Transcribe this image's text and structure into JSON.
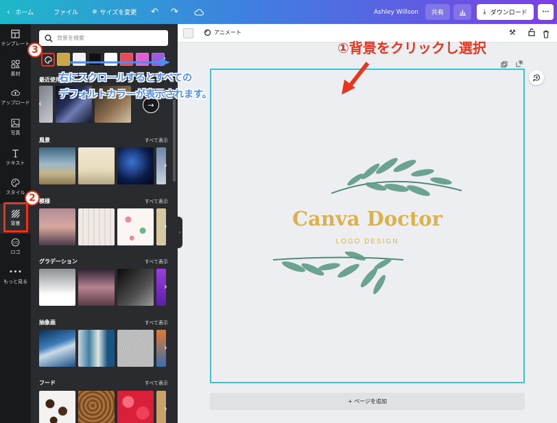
{
  "topbar": {
    "home": "ホーム",
    "file": "ファイル",
    "resize": "サイズを変更",
    "user": "Ashley Willson",
    "share": "共有",
    "download": "ダウンロード"
  },
  "rail": {
    "items": [
      {
        "label": "テンプレート",
        "icon": "layout-icon"
      },
      {
        "label": "素材",
        "icon": "shapes-icon"
      },
      {
        "label": "アップロード",
        "icon": "upload-icon"
      },
      {
        "label": "写真",
        "icon": "photo-icon"
      },
      {
        "label": "テキスト",
        "icon": "text-icon"
      },
      {
        "label": "スタイル",
        "icon": "palette-icon"
      },
      {
        "label": "背景",
        "icon": "background-icon"
      },
      {
        "label": "ロゴ",
        "icon": "logo-icon"
      },
      {
        "label": "もっと見る",
        "icon": "more-icon"
      }
    ]
  },
  "panel": {
    "search_placeholder": "背景を検索",
    "swatches": [
      "#c9a748",
      "#f2f2f2",
      "#111111",
      "#ffffff",
      "#e84a57",
      "#e25fd3",
      "#9b5be0"
    ],
    "recent_title": "最近使用",
    "sections": [
      {
        "title": "風景",
        "see_all": "すべて表示"
      },
      {
        "title": "模様",
        "see_all": "すべて表示"
      },
      {
        "title": "グラデーション",
        "see_all": "すべて表示"
      },
      {
        "title": "抽象画",
        "see_all": "すべて表示"
      },
      {
        "title": "フード",
        "see_all": "すべて表示"
      }
    ]
  },
  "toolbar": {
    "animate": "アニメート"
  },
  "design": {
    "title": "Canva Doctor",
    "subtitle": "LOGO DESIGN"
  },
  "add_page": "+ ページを追加",
  "annotations": {
    "step1": "①背景をクリックし選択",
    "step2_num": "2",
    "step3_num": "3",
    "step3_line1": "右にスクロールするとすべての",
    "step3_line2": "デフォルトカラーが表示されます。"
  },
  "colors": {
    "accent_red": "#e8351c",
    "teal_selection": "#37c4d4",
    "logo_gold": "#d9b24c"
  }
}
